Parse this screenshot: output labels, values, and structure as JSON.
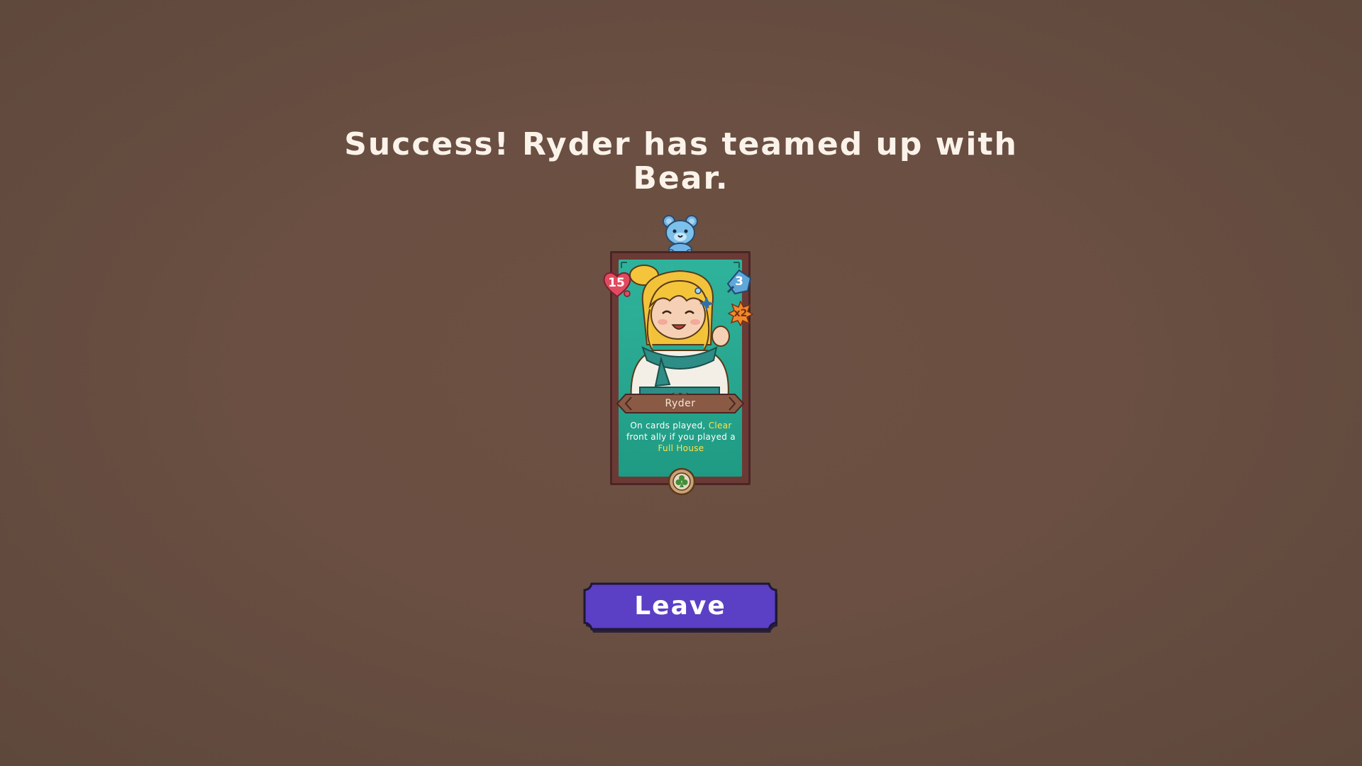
{
  "message": "Success! Ryder has teamed up with Bear.",
  "card": {
    "name": "Ryder",
    "health": "15",
    "attack": "3",
    "multiplier": "x2",
    "description": {
      "part1": "On cards played, ",
      "keyword1": "Clear",
      "part2": " front ally if you played a ",
      "keyword2": "Full House"
    },
    "charm": "bear-charm-icon",
    "suit": "club-icon"
  },
  "buttons": {
    "leave_label": "Leave"
  },
  "colors": {
    "background": "#6a4f42",
    "button": "#5b3fc4",
    "card_frame": "#6b3a35",
    "card_bg": "#2fb39c",
    "keyword": "#ffe24a"
  }
}
